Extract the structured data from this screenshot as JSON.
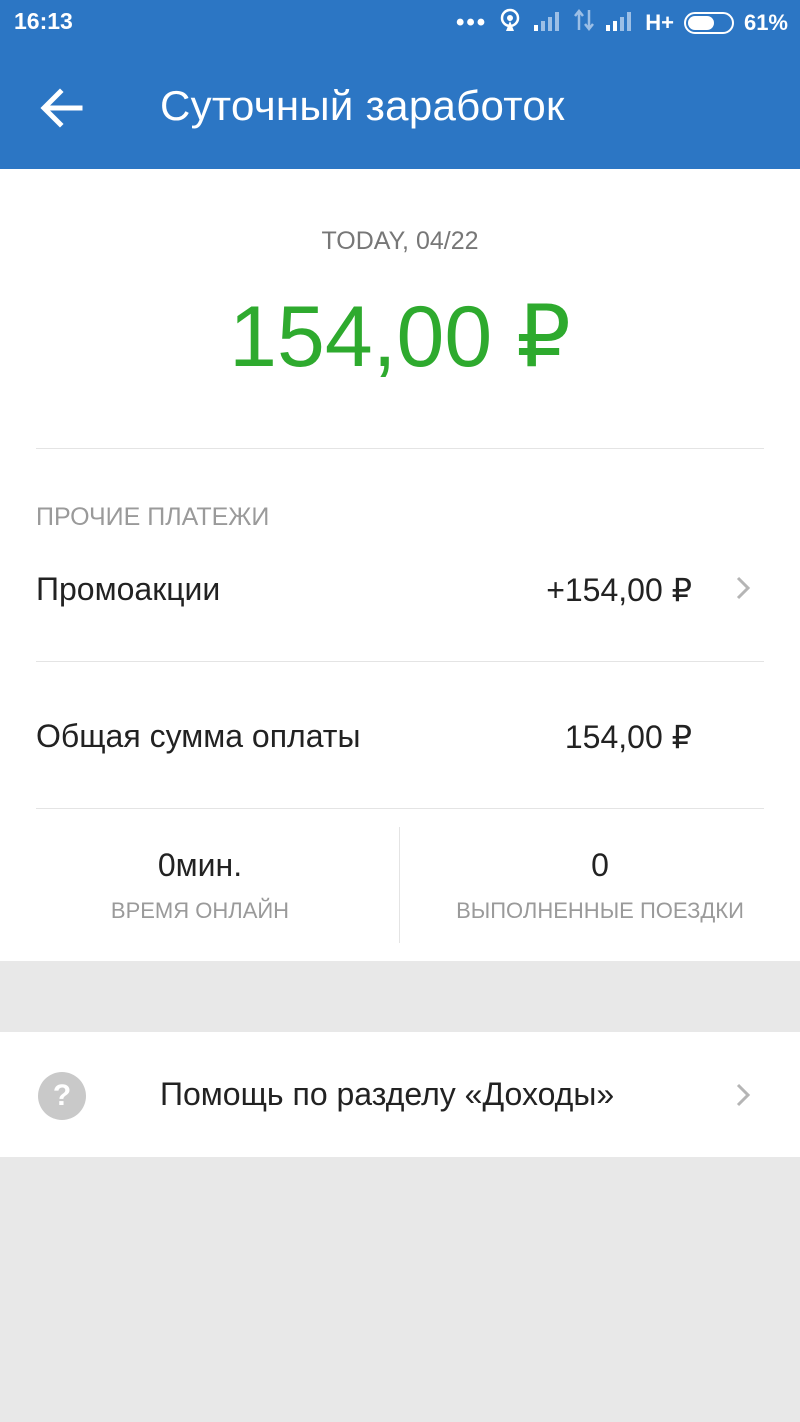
{
  "status_bar": {
    "time": "16:13",
    "network": "H+",
    "battery": "61%",
    "battery_level": 0.61
  },
  "header": {
    "title": "Суточный заработок"
  },
  "summary": {
    "date_label": "TODAY, 04/22",
    "total": "154,00 ₽"
  },
  "other_payments": {
    "section_label": "ПРОЧИЕ ПЛАТЕЖИ",
    "promo_label": "Промоакции",
    "promo_value": "+154,00 ₽"
  },
  "total_payment": {
    "label": "Общая сумма оплаты",
    "value": "154,00 ₽"
  },
  "stats": {
    "online_value": "0мин.",
    "online_label": "ВРЕМЯ ОНЛАЙН",
    "trips_value": "0",
    "trips_label": "ВЫПОЛНЕННЫЕ ПОЕЗДКИ"
  },
  "help": {
    "icon_glyph": "?",
    "label": "Помощь по разделу «Доходы»"
  },
  "colors": {
    "header_bg": "#2c76c4",
    "amount_green": "#2eaa2e"
  },
  "icons": [
    "back-arrow-icon",
    "chevron-right-icon",
    "help-icon",
    "signal-icon",
    "battery-icon"
  ]
}
